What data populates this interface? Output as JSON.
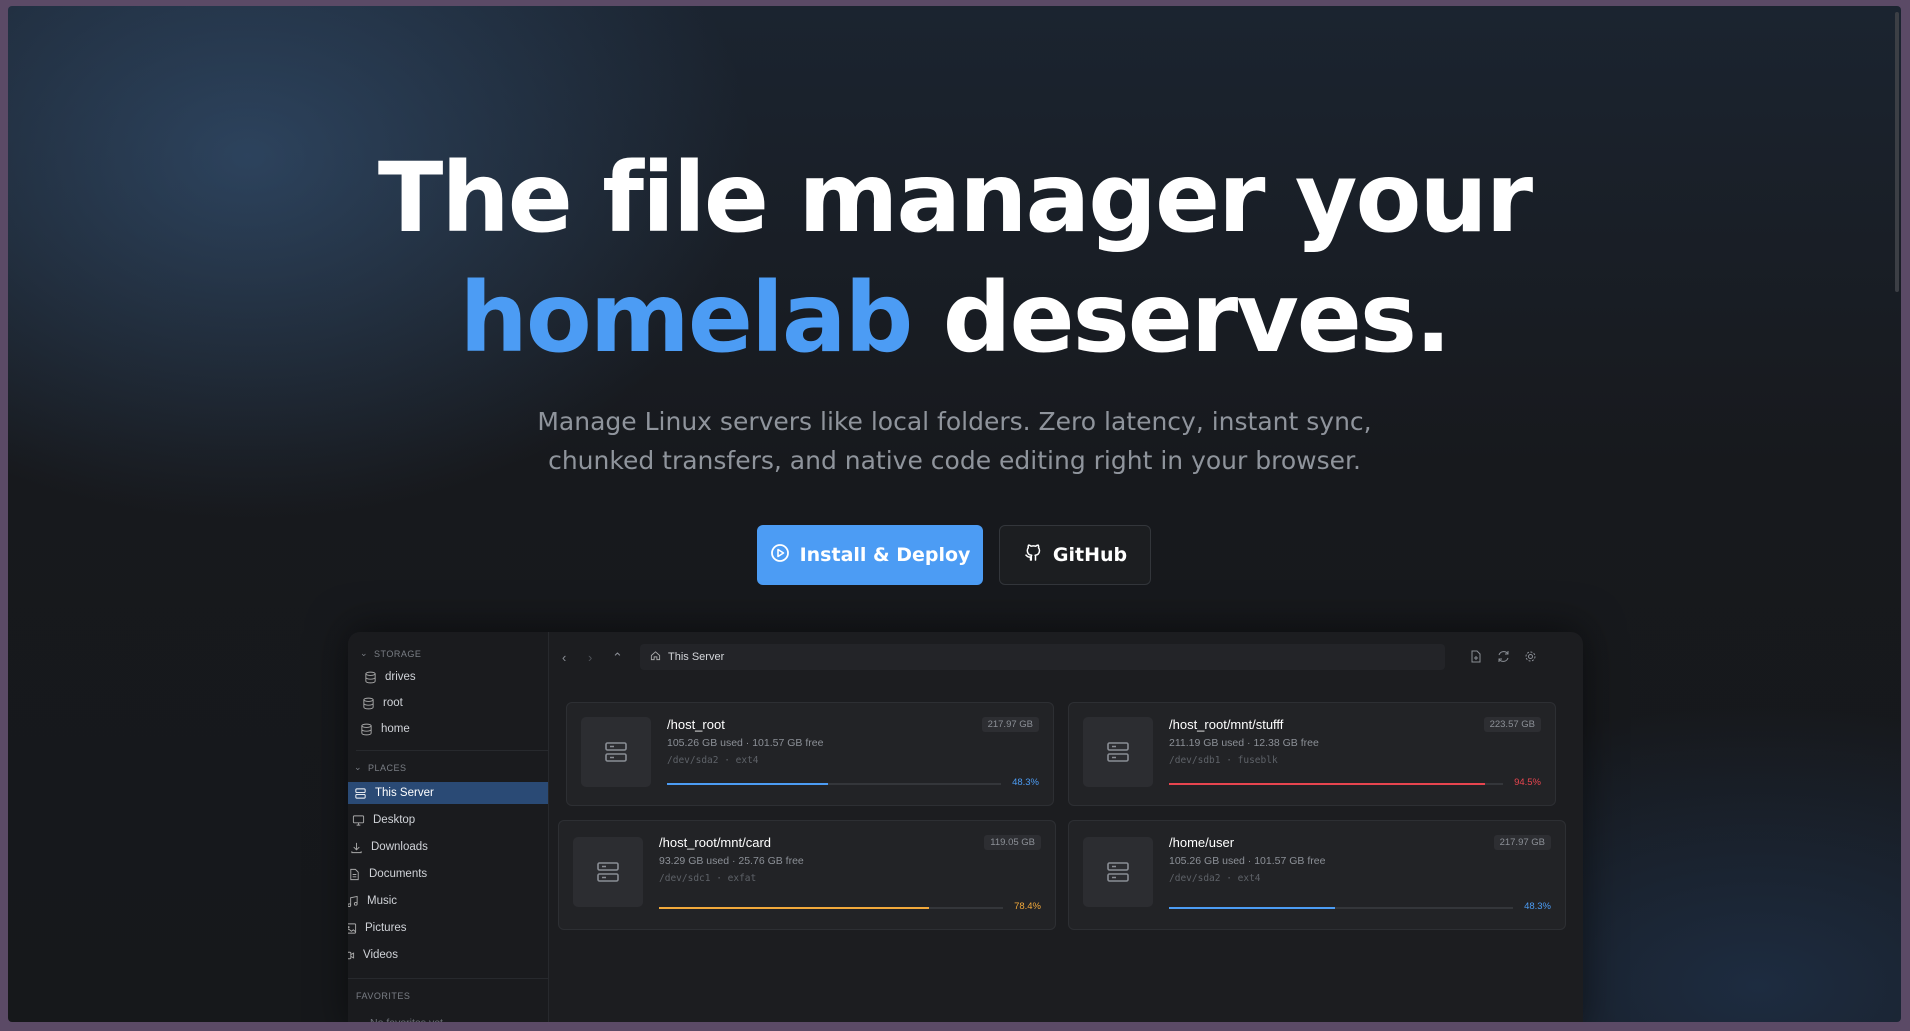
{
  "hero": {
    "title_line1": "The file manager your",
    "title_accent": "homelab",
    "title_rest": " deserves.",
    "subtitle_line1": "Manage Linux servers like local folders. Zero latency, instant sync,",
    "subtitle_line2": "chunked transfers, and native code editing right in your browser."
  },
  "buttons": {
    "install": "Install & Deploy",
    "github": "GitHub"
  },
  "colors": {
    "accent": "#4c9cf4",
    "blue_bar": "#4c9cf4",
    "red_bar": "#e8454f",
    "orange_bar": "#f2a93b"
  },
  "sidebar": {
    "storage_header": "STORAGE",
    "storage": [
      {
        "label": "drives",
        "icon": "database-icon"
      },
      {
        "label": "root",
        "icon": "database-icon"
      },
      {
        "label": "home",
        "icon": "database-icon"
      }
    ],
    "places_header": "PLACES",
    "places": [
      {
        "label": "This Server",
        "icon": "server-icon",
        "active": true
      },
      {
        "label": "Desktop",
        "icon": "monitor-icon"
      },
      {
        "label": "Downloads",
        "icon": "download-icon"
      },
      {
        "label": "Documents",
        "icon": "document-icon"
      },
      {
        "label": "Music",
        "icon": "music-icon"
      },
      {
        "label": "Pictures",
        "icon": "image-icon"
      },
      {
        "label": "Videos",
        "icon": "video-icon"
      }
    ],
    "favorites_header": "FAVORITES",
    "favorites_empty": "No favorites yet"
  },
  "toolbar": {
    "path": "This Server"
  },
  "drives": [
    {
      "name": "/host_root",
      "usage": "105.26 GB used · 101.57 GB free",
      "dev": "/dev/sda2 · ext4",
      "size": "217.97 GB",
      "percent": 48.3,
      "pct_label": "48.3%",
      "color": "#4c9cf4"
    },
    {
      "name": "/host_root/mnt/stufff",
      "usage": "211.19 GB used · 12.38 GB free",
      "dev": "/dev/sdb1 · fuseblk",
      "size": "223.57 GB",
      "percent": 94.5,
      "pct_label": "94.5%",
      "color": "#e8454f"
    },
    {
      "name": "/host_root/mnt/card",
      "usage": "93.29 GB used · 25.76 GB free",
      "dev": "/dev/sdc1 · exfat",
      "size": "119.05 GB",
      "percent": 78.4,
      "pct_label": "78.4%",
      "color": "#f2a93b"
    },
    {
      "name": "/home/user",
      "usage": "105.26 GB used · 101.57 GB free",
      "dev": "/dev/sda2 · ext4",
      "size": "217.97 GB",
      "percent": 48.3,
      "pct_label": "48.3%",
      "color": "#4c9cf4"
    }
  ]
}
